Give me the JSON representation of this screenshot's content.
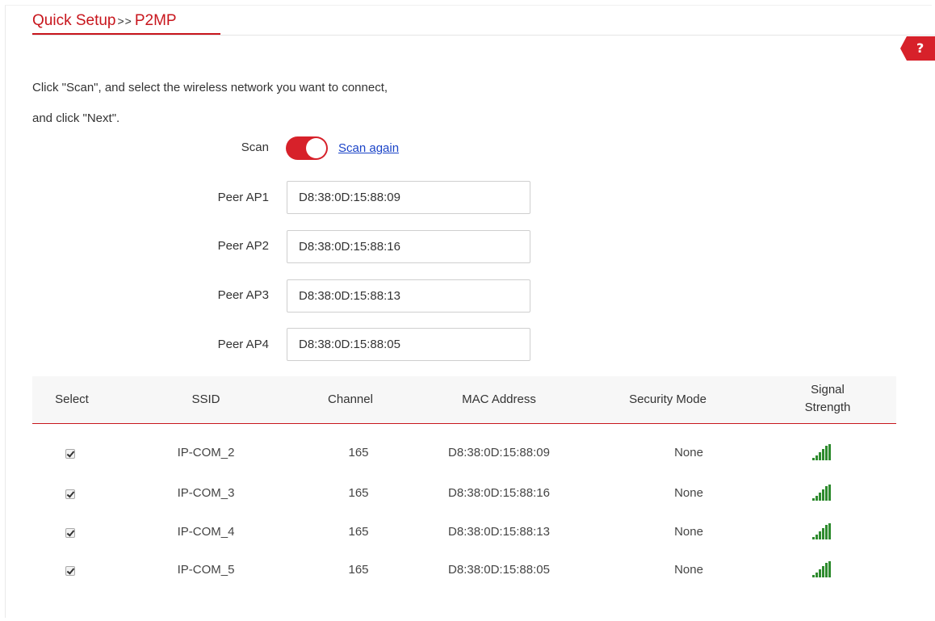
{
  "breadcrumb": {
    "parent": "Quick Setup",
    "separator": ">>",
    "current": "P2MP"
  },
  "help": {
    "label": "?"
  },
  "instruction": {
    "line1": "Click \"Scan\", and select the wireless network you want to connect,",
    "line2": "and click \"Next\"."
  },
  "scan": {
    "label": "Scan",
    "enabled": true,
    "scan_again": "Scan again"
  },
  "peers": [
    {
      "label": "Peer AP1",
      "value": "D8:38:0D:15:88:09"
    },
    {
      "label": "Peer AP2",
      "value": "D8:38:0D:15:88:16"
    },
    {
      "label": "Peer AP3",
      "value": "D8:38:0D:15:88:13"
    },
    {
      "label": "Peer AP4",
      "value": "D8:38:0D:15:88:05"
    }
  ],
  "table": {
    "headers": {
      "select": "Select",
      "ssid": "SSID",
      "channel": "Channel",
      "mac": "MAC Address",
      "security": "Security Mode",
      "signal_line1": "Signal",
      "signal_line2": "Strength"
    },
    "rows": [
      {
        "selected": true,
        "ssid": "IP-COM_2",
        "channel": "165",
        "mac": "D8:38:0D:15:88:09",
        "security": "None",
        "signal": "signal-strength-icon"
      },
      {
        "selected": true,
        "ssid": "IP-COM_3",
        "channel": "165",
        "mac": "D8:38:0D:15:88:16",
        "security": "None",
        "signal": "signal-strength-icon"
      },
      {
        "selected": true,
        "ssid": "IP-COM_4",
        "channel": "165",
        "mac": "D8:38:0D:15:88:13",
        "security": "None",
        "signal": "signal-strength-icon"
      },
      {
        "selected": true,
        "ssid": "IP-COM_5",
        "channel": "165",
        "mac": "D8:38:0D:15:88:05",
        "security": "None",
        "signal": "signal-strength-icon"
      }
    ]
  },
  "colors": {
    "accent": "#c8161d",
    "toggle_on": "#d7212a",
    "link": "#1b44c8",
    "signal_green": "#2e8b2e"
  }
}
